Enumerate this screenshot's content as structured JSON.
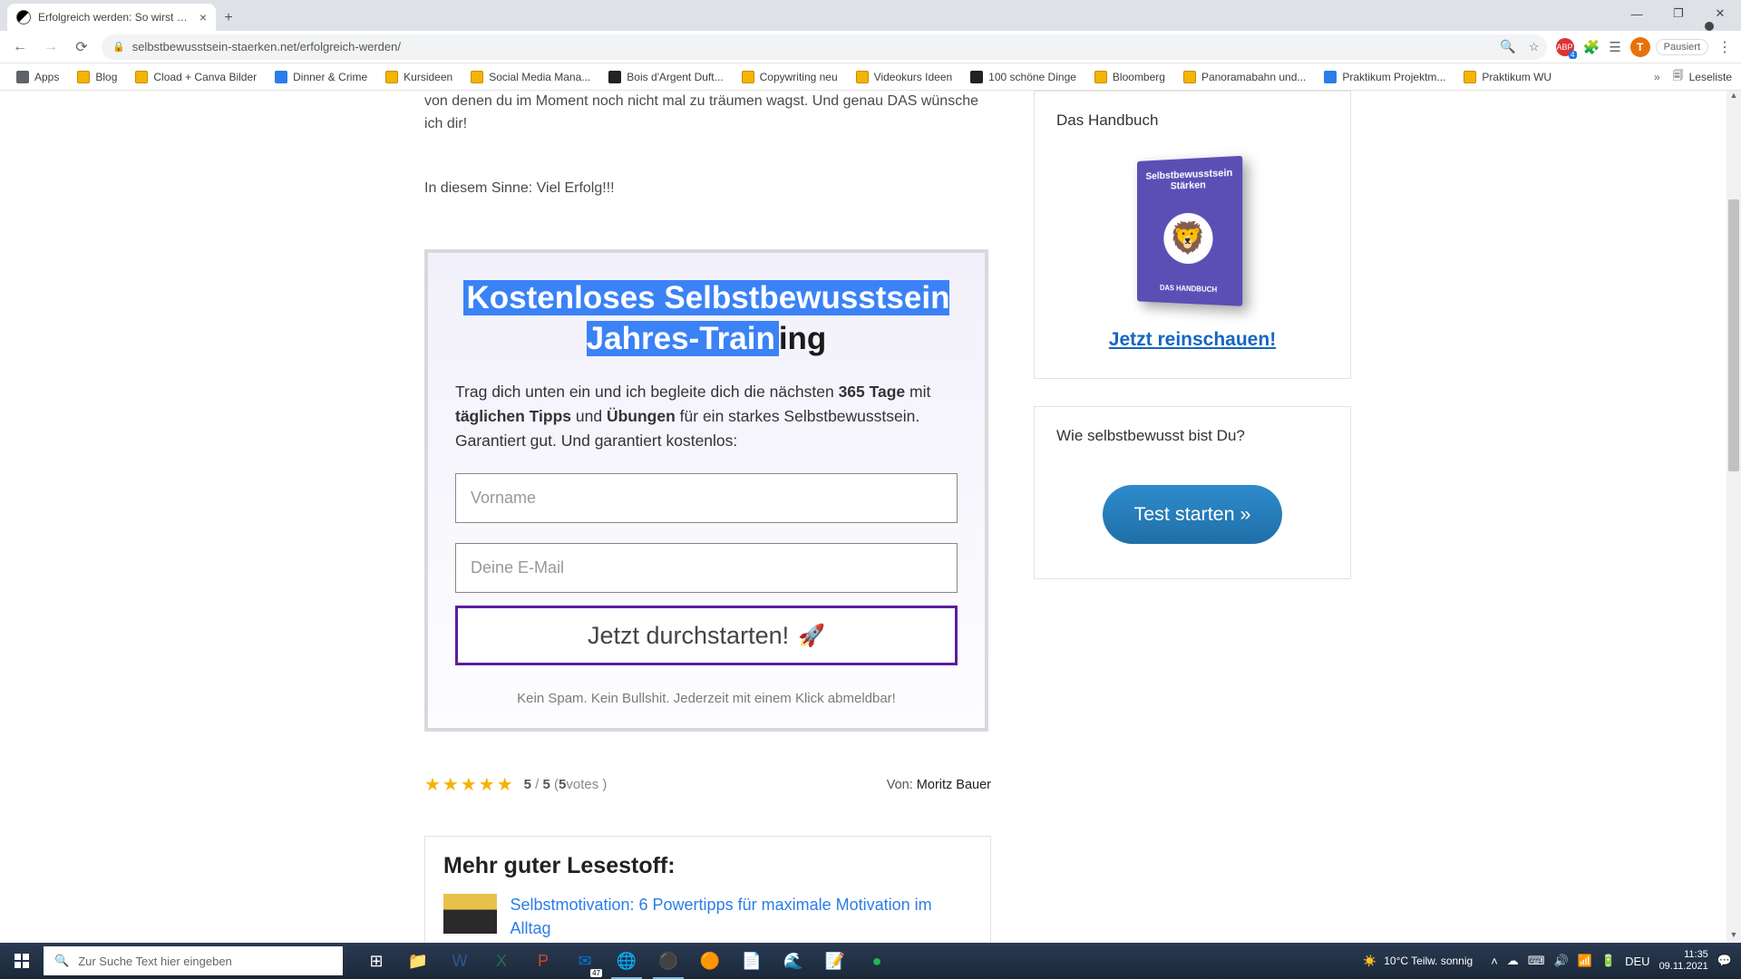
{
  "browser": {
    "tab_title": "Erfolgreich werden: So wirst du g",
    "url": "selbstbewusstsein-staerken.net/erfolgreich-werden/",
    "profile_initial": "T",
    "paused_label": "Pausiert",
    "ext_badge": "ABP",
    "ext_count": "4",
    "bookmarks": {
      "apps": "Apps",
      "items": [
        "Blog",
        "Cload + Canva Bilder",
        "Dinner & Crime",
        "Kursideen",
        "Social Media Mana...",
        "Bois d'Argent Duft...",
        "Copywriting neu",
        "Videokurs Ideen",
        "100 schöne Dinge",
        "Bloomberg",
        "Panoramabahn und...",
        "Praktikum Projektm...",
        "Praktikum WU"
      ],
      "readlist": "Leseliste"
    }
  },
  "article": {
    "tail1": "von denen du im Moment noch nicht mal zu träumen wagst. Und genau DAS wünsche ich dir!",
    "tail2": "In diesem Sinne: Viel Erfolg!!!"
  },
  "optin": {
    "headline_sel": "Kostenloses Selbstbewusstsein Jahres-Train",
    "headline_rest": "ing",
    "desc_a": "Trag dich unten ein und ich begleite dich die nächsten ",
    "desc_b": "365 Tage",
    "desc_c": " mit ",
    "desc_d": "täglichen Tipps",
    "desc_e": " und ",
    "desc_f": "Übungen",
    "desc_g": " für ein starkes Selbstbewusstsein. Garantiert gut. Und garantiert kostenlos:",
    "ph_name": "Vorname",
    "ph_email": "Deine E-Mail",
    "cta": "Jetzt durchstarten!",
    "note": "Kein Spam. Kein Bullshit. Jederzeit mit einem Klick abmeldbar!"
  },
  "rating": {
    "score": "5",
    "sep": "/",
    "max": "5",
    "open": "( ",
    "count": "5",
    "votes": " votes )"
  },
  "byline": {
    "prefix": "Von: ",
    "author": "Moritz Bauer"
  },
  "more": {
    "title": "Mehr guter Lesestoff:",
    "item1": "Selbstmotivation: 6 Powertipps für maximale Motivation im Alltag"
  },
  "side": {
    "handbuch_hd": "Das Handbuch",
    "book_t1": "Selbstbewusstsein",
    "book_t2": "Stärken",
    "book_sub": "DAS HANDBUCH",
    "reinschauen": "Jetzt reinschauen!",
    "quiz_hd": "Wie selbstbewusst bist Du?",
    "quiz_btn": "Test starten »"
  },
  "taskbar": {
    "search_ph": "Zur Suche Text hier eingeben",
    "weather": "10°C  Teilw. sonnig",
    "lang": "DEU",
    "time": "11:35",
    "date": "09.11.2021",
    "outlook_badge": "47"
  }
}
